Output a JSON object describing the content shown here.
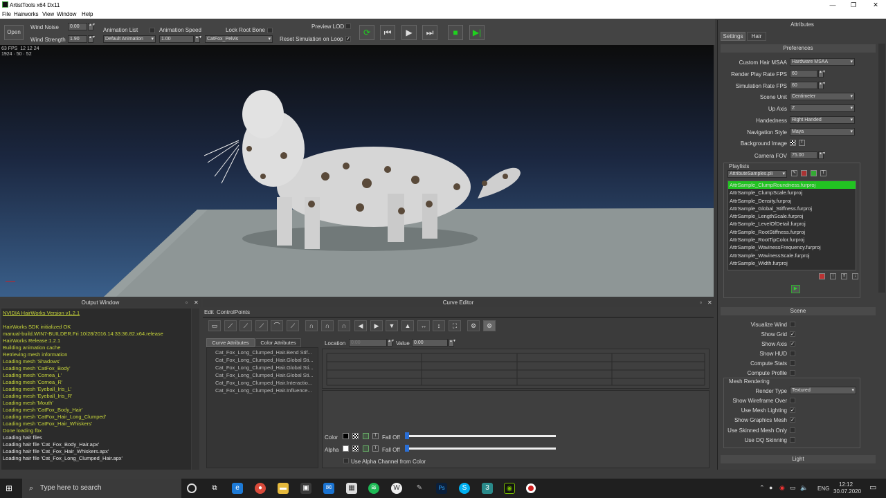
{
  "window": {
    "title": "ArtistTools x64 Dx11"
  },
  "menu": [
    "File",
    "Hairworks",
    "View",
    "Window",
    "Help"
  ],
  "toolbar": {
    "open_label": "Open",
    "wind_noise_label": "Wind Noise",
    "wind_noise_value": "0.00",
    "wind_strength_label": "Wind Strength",
    "wind_strength_value": "1.90",
    "animation_list_label": "Animation List",
    "animation_list_value": "Default Animation",
    "animation_speed_label": "Animation Speed",
    "animation_speed_value": "1.00",
    "lock_root_bone_label": "Lock Root Bone",
    "root_bone_value": "CatFox_Pelvis",
    "preview_lod_label": "Preview LOD",
    "reset_sim_label": "Reset Simulation on Loop",
    "reset_sim_checked": "✓",
    "buttons": [
      "reset-icon",
      "skip-back-icon",
      "play-icon",
      "skip-forward-icon",
      "stop-icon",
      "step-icon"
    ]
  },
  "viewport": {
    "fps": "63 FPS",
    "time": "12 12 24",
    "resolution": "1924 · 50 · 52",
    "axis_color": "#d02020"
  },
  "attributes": {
    "title": "Attributes",
    "tabs": [
      "Settings",
      "Hair"
    ],
    "preferences_header": "Preferences",
    "prefs": [
      {
        "label": "Custom Hair MSAA",
        "value": "Hardware MSAA",
        "kind": "dropdown"
      },
      {
        "label": "Render Play Rate FPS",
        "value": "60",
        "kind": "spin"
      },
      {
        "label": "Simulation Rate FPS",
        "value": "60",
        "kind": "spin"
      },
      {
        "label": "Scene Unit",
        "value": "Centimeter",
        "kind": "dropdown"
      },
      {
        "label": "Up Axis",
        "value": "Z",
        "kind": "dropdown"
      },
      {
        "label": "Handedness",
        "value": "Right Handed",
        "kind": "dropdown"
      },
      {
        "label": "Navigation Style",
        "value": "Maya",
        "kind": "dropdown"
      }
    ],
    "background_image_label": "Background Image",
    "camera_fov_label": "Camera FOV",
    "camera_fov_value": "75.00",
    "playlists_label": "Playlists",
    "playlist_selected": "AttributeSamples.pli",
    "playlist_items": [
      "AttrSample_ClumpRoundness.furproj",
      "AttrSample_ClumpScale.furproj",
      "AttrSample_Density.furproj",
      "AttrSample_Global_Stiffness.furproj",
      "AttrSample_LengthScale.furproj",
      "AttrSample_LevelOfDetail.furproj",
      "AttrSample_RootStiffness.furproj",
      "AttrSample_RootTipColor.furproj",
      "AttrSample_WavinessFrequency.furproj",
      "AttrSample_WavinessScale.furproj",
      "AttrSample_Width.furproj"
    ],
    "playlist_highlight_color": "#22c322",
    "scene_header": "Scene",
    "scene_checks": [
      {
        "label": "Visualize Wind",
        "checked": ""
      },
      {
        "label": "Show Grid",
        "checked": "✓"
      },
      {
        "label": "Show Axis",
        "checked": "✓"
      },
      {
        "label": "Show HUD",
        "checked": ""
      },
      {
        "label": "Compute Stats",
        "checked": ""
      },
      {
        "label": "Compute Profile",
        "checked": ""
      }
    ],
    "mesh_rendering_label": "Mesh Rendering",
    "render_type_label": "Render Type",
    "render_type_value": "Textured",
    "mesh_checks": [
      {
        "label": "Show Wireframe Over",
        "checked": ""
      },
      {
        "label": "Use Mesh Lighting",
        "checked": "✓"
      },
      {
        "label": "Show Graphics Mesh",
        "checked": "✓"
      },
      {
        "label": "Use Skinned Mesh Only",
        "checked": ""
      },
      {
        "label": "Use DQ Skinning",
        "checked": ""
      }
    ],
    "light_header": "Light"
  },
  "output": {
    "title": "Output Window",
    "lines": [
      {
        "text": "NVIDIA HairWorks Version v1.2.1",
        "color": "yellow"
      },
      {
        "text": "",
        "color": "yellow"
      },
      {
        "text": "HairWorks SDK initialized OK",
        "color": "yellow"
      },
      {
        "text": "manual-build.WIN7-BUILDER.Fri 10/28/2016.14:33:36.82.x64.release",
        "color": "yellow"
      },
      {
        "text": "HairWorks Release:1.2.1",
        "color": "yellow"
      },
      {
        "text": "Building animation cache",
        "color": "yellow"
      },
      {
        "text": "Retrieving mesh information",
        "color": "yellow"
      },
      {
        "text": "Loading mesh 'Shadows'",
        "color": "yellow"
      },
      {
        "text": "Loading mesh 'CatFox_Body'",
        "color": "yellow"
      },
      {
        "text": "Loading mesh 'Cornea_L'",
        "color": "yellow"
      },
      {
        "text": "Loading mesh 'Cornea_R'",
        "color": "yellow"
      },
      {
        "text": "Loading mesh 'Eyeball_Iris_L'",
        "color": "yellow"
      },
      {
        "text": "Loading mesh 'Eyeball_Iris_R'",
        "color": "yellow"
      },
      {
        "text": "Loading mesh 'Mouth'",
        "color": "yellow"
      },
      {
        "text": "Loading mesh 'CatFox_Body_Hair'",
        "color": "yellow"
      },
      {
        "text": "Loading mesh 'CatFox_Hair_Long_Clumped'",
        "color": "yellow"
      },
      {
        "text": "Loading mesh 'CatFox_Hair_Whiskers'",
        "color": "yellow"
      },
      {
        "text": "Done loading fbx",
        "color": "yellow"
      },
      {
        "text": "Loading hair files",
        "color": "white"
      },
      {
        "text": "Loading hair file 'Cat_Fox_Body_Hair.apx'",
        "color": "white"
      },
      {
        "text": "Loading hair file 'Cat_Fox_Hair_Whiskers.apx'",
        "color": "white"
      },
      {
        "text": "Loading hair file 'Cat_Fox_Long_Clumped_Hair.apx'",
        "color": "white"
      }
    ]
  },
  "curve_editor": {
    "title": "Curve Editor",
    "menu": [
      "Edit",
      "ControlPoints"
    ],
    "tabs": [
      "Curve Attributes",
      "Color Attributes"
    ],
    "attributes": [
      "Cat_Fox_Long_Clumped_Hair.Bend Stif...",
      "Cat_Fox_Long_Clumped_Hair.Global Sti...",
      "Cat_Fox_Long_Clumped_Hair.Global Sti...",
      "Cat_Fox_Long_Clumped_Hair.Global Sti...",
      "Cat_Fox_Long_Clumped_Hair.Interactio...",
      "Cat_Fox_Long_Clumped_Hair.Influence..."
    ],
    "location_label": "Location",
    "location_value": "0.00",
    "value_label": "Value",
    "value_value": "0.00",
    "color_label": "Color",
    "alpha_label": "Alpha",
    "falloff_label": "Fall Off",
    "use_alpha_label": "Use Alpha Channel from Color"
  },
  "taskbar": {
    "search_placeholder": "Type here to search",
    "lang": "ENG",
    "time": "12:12",
    "date": "30.07.2020"
  }
}
